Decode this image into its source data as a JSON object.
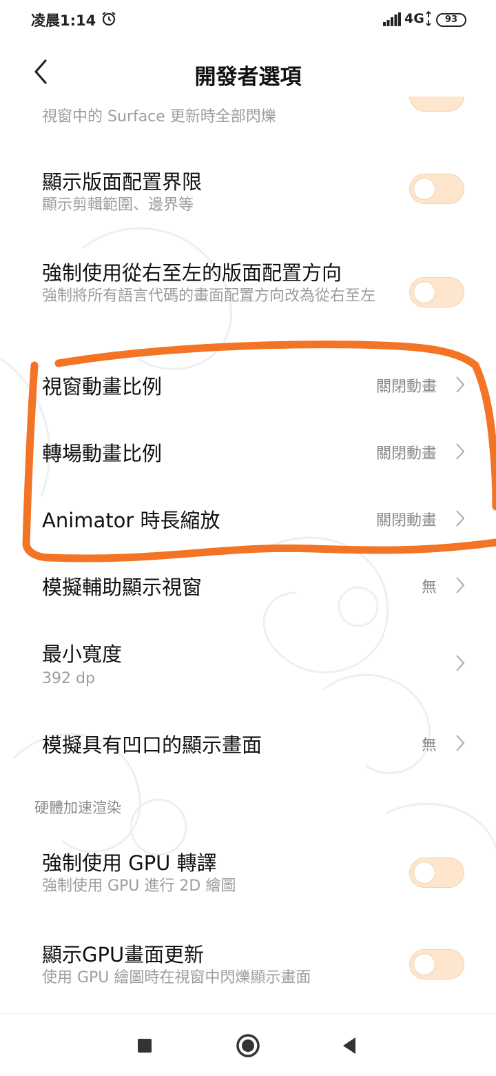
{
  "status_bar": {
    "time": "凌晨1:14",
    "alarm_icon": "alarm-clock-icon",
    "network": "4G",
    "battery": "93"
  },
  "header": {
    "back_icon": "chevron-left-icon",
    "title": "開發者選項"
  },
  "partial_row": {
    "subtitle": "視窗中的 Surface 更新時全部閃爍"
  },
  "rows": [
    {
      "title": "顯示版面配置界限",
      "subtitle": "顯示剪輯範圍、邊界等",
      "control": "toggle",
      "on": false
    },
    {
      "title": "強制使用從右至左的版面配置方向",
      "subtitle": "強制將所有語言代碼的畫面配置方向改為從右至左",
      "control": "toggle",
      "on": false
    },
    {
      "title": "視窗動畫比例",
      "value": "關閉動畫",
      "control": "chevron"
    },
    {
      "title": "轉場動畫比例",
      "value": "關閉動畫",
      "control": "chevron"
    },
    {
      "title": "Animator 時長縮放",
      "value": "關閉動畫",
      "control": "chevron"
    },
    {
      "title": "模擬輔助顯示視窗",
      "value": "無",
      "control": "chevron"
    },
    {
      "title": "最小寬度",
      "subtitle": "392 dp",
      "control": "chevron"
    },
    {
      "title": "模擬具有凹口的顯示畫面",
      "value": "無",
      "control": "chevron"
    }
  ],
  "section": {
    "title": "硬體加速渲染"
  },
  "gpu_rows": [
    {
      "title": "強制使用 GPU 轉譯",
      "subtitle": "強制使用 GPU 進行 2D 繪圖",
      "control": "toggle",
      "on": false
    },
    {
      "title": "顯示GPU畫面更新",
      "subtitle": "使用 GPU 繪圖時在視窗中閃爍顯示畫面",
      "control": "toggle",
      "on": false
    }
  ],
  "annotation": {
    "color": "#f27424",
    "shape": "hand-drawn-loop"
  },
  "colors": {
    "toggle_off_track": "#fde6cd",
    "secondary_text": "#9d9d9d"
  },
  "nav_bar": {
    "recents_icon": "square-recents-icon",
    "home_icon": "circle-home-icon",
    "back_icon": "triangle-back-icon"
  }
}
